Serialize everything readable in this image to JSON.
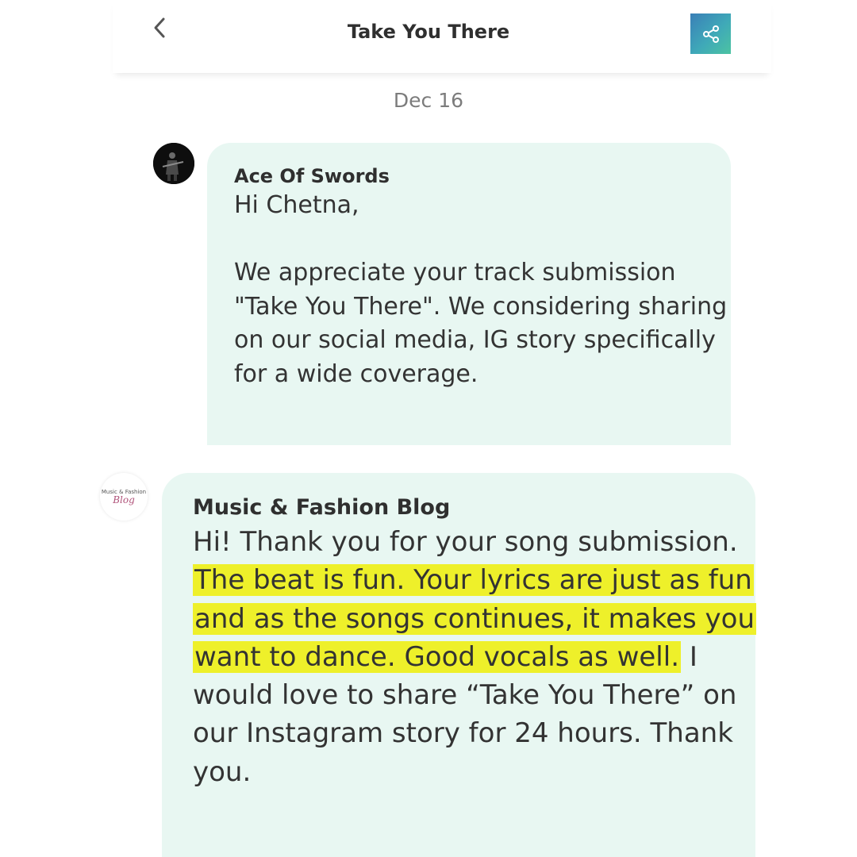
{
  "header": {
    "title": "Take You There",
    "back_icon": "chevron-left-icon",
    "share_icon": "share-icon"
  },
  "date_separator": "Dec 16",
  "messages": [
    {
      "sender": "Ace Of Swords",
      "greeting": "Hi Chetna,",
      "body": "We appreciate your track submission \"Take You There\". We considering sharing on our social media, IG story specifically for a wide coverage."
    },
    {
      "sender": "Music & Fashion Blog",
      "avatar_text_top": "Music & Fashion",
      "avatar_text_bottom": "Blog",
      "text_before": "Hi! Thank you for your song submission.",
      "text_highlighted": "The beat is fun. Your lyrics are just as fun and as the songs continues, it makes you want to dance. Good vocals as well.",
      "text_after": "I would love to share “Take You There” on our Instagram story for 24 hours. Thank you."
    }
  ],
  "colors": {
    "bubble": "#e8f7f2",
    "highlight": "#eef02a",
    "share_gradient_start": "#3a7fb7",
    "share_gradient_end": "#4cc3a2"
  }
}
